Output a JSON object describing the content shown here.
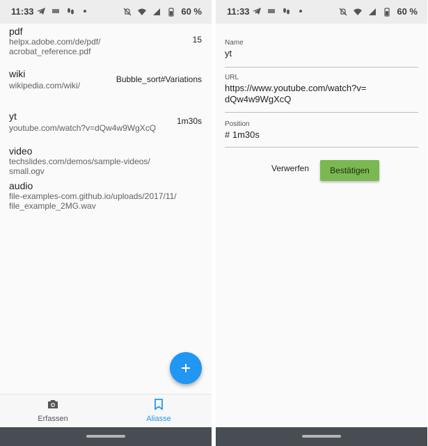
{
  "status_bar": {
    "time": "11:33",
    "battery": "60 %"
  },
  "aliases": [
    {
      "name": "pdf",
      "url": "helpx.adobe.com/de/pdf/\nacrobat_reference.pdf",
      "suffix": "15"
    },
    {
      "name": "wiki",
      "url": "wikipedia.com/wiki/",
      "suffix": "Bubble_sort#Variations"
    },
    {
      "name": "yt",
      "url": "youtube.com/watch?v=dQw4w9WgXcQ",
      "suffix": "1m30s"
    },
    {
      "name": "video",
      "url": "techslides.com/demos/sample-videos/\nsmall.ogv",
      "suffix": ""
    },
    {
      "name": "audio",
      "url": "file-examples-com.github.io/uploads/2017/11/\nfile_example_2MG.wav",
      "suffix": ""
    }
  ],
  "fab": {
    "icon": "plus-icon"
  },
  "bottom_nav": {
    "capture_label": "Erfassen",
    "aliases_label": "Aliasse",
    "active_color": "#2196f3"
  },
  "form": {
    "name_label": "Name",
    "name_value": "yt",
    "url_label": "URL",
    "url_value": "https://www.youtube.com/watch?v=\ndQw4w9WgXcQ",
    "position_label": "Position",
    "position_value": "# 1m30s",
    "discard_label": "Verwerfen",
    "confirm_label": "Bestätigen",
    "confirm_color": "#7cb851"
  }
}
